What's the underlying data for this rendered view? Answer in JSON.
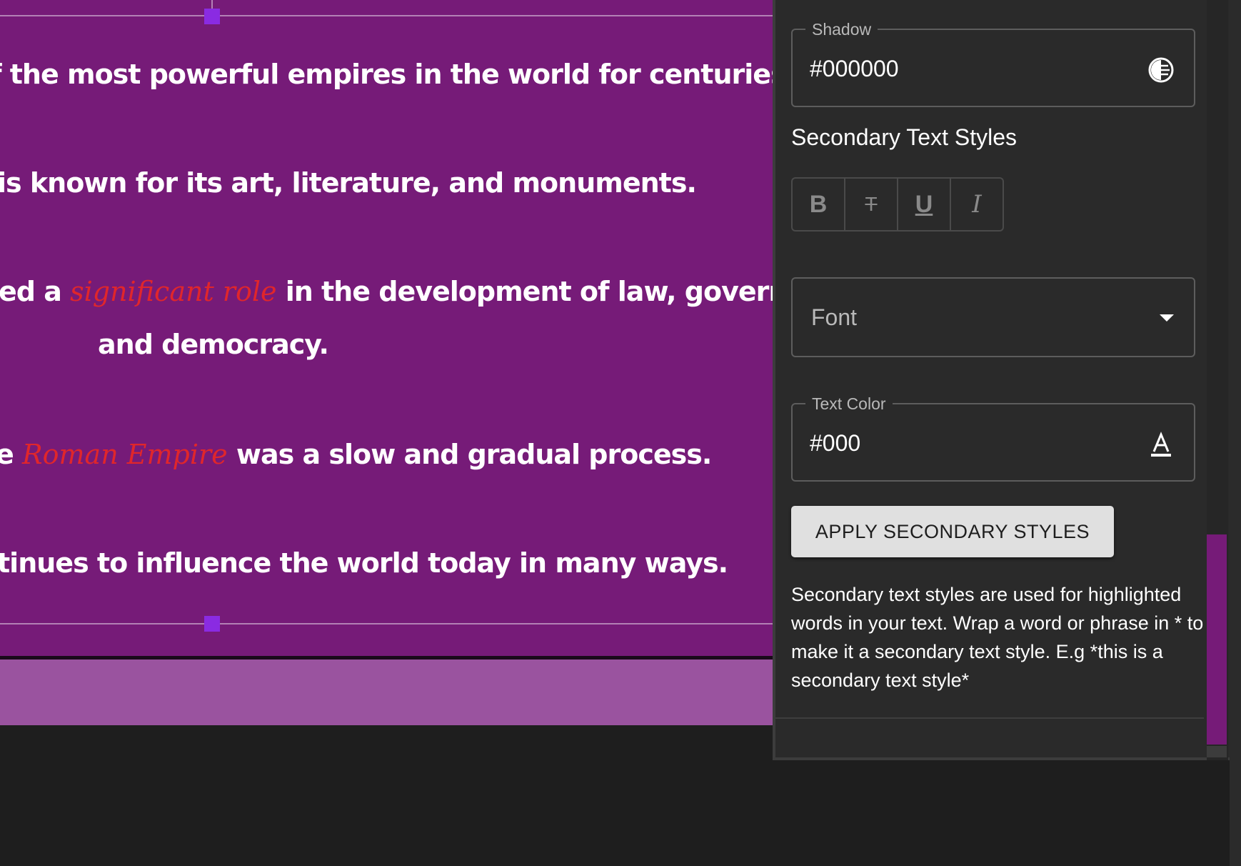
{
  "canvas": {
    "lines": [
      {
        "text": "f the most powerful empires in the world for centuries."
      },
      {
        "text": "is known for its art, literature, and monuments."
      },
      {
        "pre": "ed a ",
        "highlight": "significant role",
        "post": " in the development of law, government"
      },
      {
        "text": "and democracy."
      },
      {
        "pre": "e ",
        "highlight": "Roman Empire",
        "post": " was a slow and gradual process."
      },
      {
        "text": "tinues to influence the world today in many ways."
      }
    ],
    "colors": {
      "background": "#761b78",
      "highlight": "#e0262b",
      "band": "#9a539f"
    }
  },
  "panel": {
    "shadow": {
      "label": "Shadow",
      "value": "#000000",
      "icon": "color-picker-icon"
    },
    "section_title": "Secondary Text Styles",
    "style_buttons": [
      {
        "glyph": "B",
        "icon": "bold-icon"
      },
      {
        "glyph": "T",
        "icon": "strikethrough-icon"
      },
      {
        "glyph": "U",
        "icon": "underline-icon"
      },
      {
        "glyph": "I",
        "icon": "italic-icon"
      }
    ],
    "font": {
      "label": "Font",
      "icon": "chevron-down-icon"
    },
    "text_color": {
      "label": "Text Color",
      "value": "#000",
      "icon": "text-color-icon"
    },
    "apply_button": "APPLY SECONDARY STYLES",
    "help_text": "Secondary text styles are used for highlighted words in your text. Wrap a word or phrase in * to make it a secondary text style. E.g *this is a secondary text style*"
  }
}
